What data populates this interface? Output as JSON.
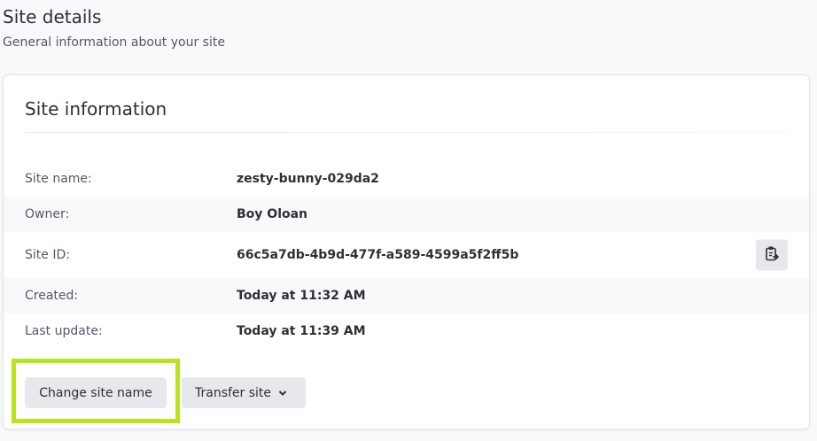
{
  "header": {
    "title": "Site details",
    "subtitle": "General information about your site"
  },
  "card": {
    "title": "Site information",
    "rows": [
      {
        "label": "Site name:",
        "value": "zesty-bunny-029da2"
      },
      {
        "label": "Owner:",
        "value": "Boy Oloan"
      },
      {
        "label": "Site ID:",
        "value": "66c5a7db-4b9d-477f-a589-4599a5f2ff5b"
      },
      {
        "label": "Created:",
        "value": "Today at 11:32 AM"
      },
      {
        "label": "Last update:",
        "value": "Today at 11:39 AM"
      }
    ],
    "copy_icon": "clipboard-copy-icon"
  },
  "actions": {
    "change_site_name": "Change site name",
    "transfer_site": "Transfer site",
    "transfer_icon": "chevron-down-icon"
  },
  "colors": {
    "highlight": "#b6e41d",
    "button_bg": "#e6e8eb",
    "text": "#2e3038",
    "muted": "#545869"
  }
}
